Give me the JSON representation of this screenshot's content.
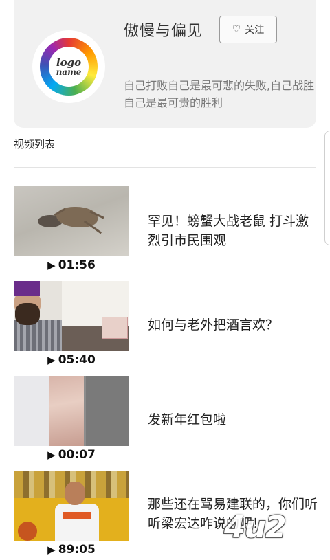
{
  "profile": {
    "logo_line1": "logo",
    "logo_line2": "name",
    "name": "傲慢与偏见",
    "follow_label": "关注",
    "follow_icon": "heart-outline-icon",
    "motto": "自己打败自己是最可悲的失败,自己战胜自己是最可贵的胜利"
  },
  "section": {
    "title": "视频列表"
  },
  "videos": [
    {
      "title": "罕见！螃蟹大战老鼠 打斗激烈引市民围观",
      "duration": "01:56",
      "play_icon": "▶"
    },
    {
      "title": "如何与老外把酒言欢？",
      "duration": "05:40",
      "play_icon": "▶"
    },
    {
      "title": "发新年红包啦",
      "duration": "00:07",
      "play_icon": "▶"
    },
    {
      "title": "那些还在骂易建联的，你们听听梁宏达咋说的吧！",
      "duration": "89:05",
      "play_icon": "▶"
    }
  ],
  "watermark": "4u2"
}
